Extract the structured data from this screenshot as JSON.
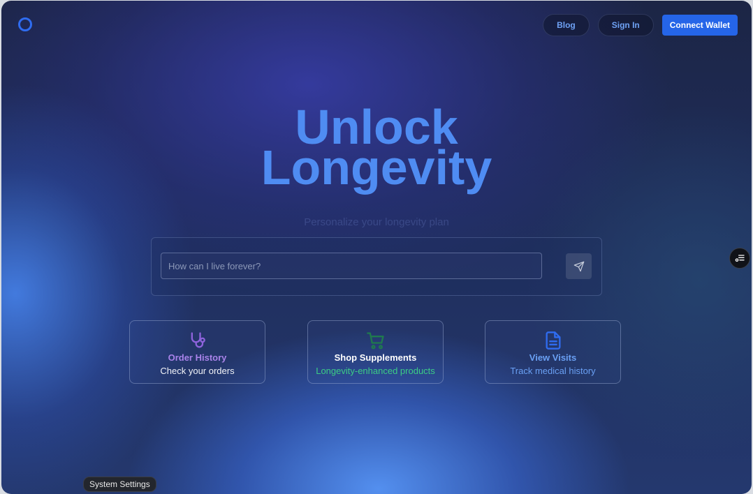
{
  "header": {
    "logo_icon": "ring-logo-icon",
    "nav": {
      "blog_label": "Blog",
      "signin_label": "Sign In",
      "connect_label": "Connect Wallet"
    }
  },
  "hero": {
    "title_line1": "Unlock",
    "title_line2": "Longevity",
    "subtitle": "Personalize your longevity plan"
  },
  "search": {
    "placeholder": "How can I live forever?",
    "value": "",
    "send_icon": "send-icon"
  },
  "cards": [
    {
      "icon": "stethoscope-icon",
      "title": "Order History",
      "desc": "Check your orders",
      "title_color": "#a983ea",
      "desc_color": "#f1f3f8"
    },
    {
      "icon": "shopping-cart-icon",
      "title": "Shop Supplements",
      "desc": "Longevity-enhanced products",
      "title_color": "#ffffff",
      "desc_color": "#3ccd86"
    },
    {
      "icon": "document-icon",
      "title": "View Visits",
      "desc": "Track medical history",
      "title_color": "#6aa0f4",
      "desc_color": "#6aa0f4"
    }
  ],
  "side_button_icon": "settings-toggle-icon",
  "tooltip": "System Settings",
  "colors": {
    "accent": "#2565e8",
    "hero_text": "#4f8cf2"
  }
}
